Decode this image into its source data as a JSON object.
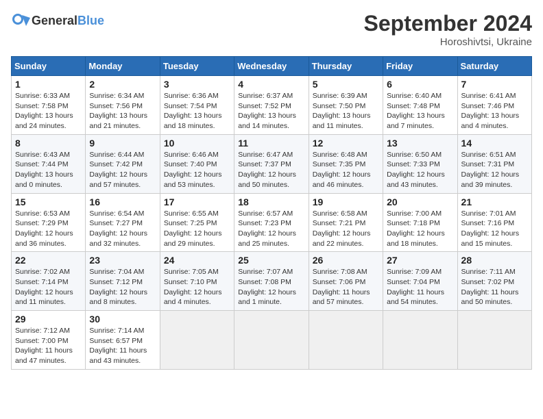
{
  "header": {
    "logo_general": "General",
    "logo_blue": "Blue",
    "month": "September 2024",
    "location": "Horoshivtsi, Ukraine"
  },
  "weekdays": [
    "Sunday",
    "Monday",
    "Tuesday",
    "Wednesday",
    "Thursday",
    "Friday",
    "Saturday"
  ],
  "weeks": [
    [
      {
        "day": 1,
        "info": "Sunrise: 6:33 AM\nSunset: 7:58 PM\nDaylight: 13 hours\nand 24 minutes."
      },
      {
        "day": 2,
        "info": "Sunrise: 6:34 AM\nSunset: 7:56 PM\nDaylight: 13 hours\nand 21 minutes."
      },
      {
        "day": 3,
        "info": "Sunrise: 6:36 AM\nSunset: 7:54 PM\nDaylight: 13 hours\nand 18 minutes."
      },
      {
        "day": 4,
        "info": "Sunrise: 6:37 AM\nSunset: 7:52 PM\nDaylight: 13 hours\nand 14 minutes."
      },
      {
        "day": 5,
        "info": "Sunrise: 6:39 AM\nSunset: 7:50 PM\nDaylight: 13 hours\nand 11 minutes."
      },
      {
        "day": 6,
        "info": "Sunrise: 6:40 AM\nSunset: 7:48 PM\nDaylight: 13 hours\nand 7 minutes."
      },
      {
        "day": 7,
        "info": "Sunrise: 6:41 AM\nSunset: 7:46 PM\nDaylight: 13 hours\nand 4 minutes."
      }
    ],
    [
      {
        "day": 8,
        "info": "Sunrise: 6:43 AM\nSunset: 7:44 PM\nDaylight: 13 hours\nand 0 minutes."
      },
      {
        "day": 9,
        "info": "Sunrise: 6:44 AM\nSunset: 7:42 PM\nDaylight: 12 hours\nand 57 minutes."
      },
      {
        "day": 10,
        "info": "Sunrise: 6:46 AM\nSunset: 7:40 PM\nDaylight: 12 hours\nand 53 minutes."
      },
      {
        "day": 11,
        "info": "Sunrise: 6:47 AM\nSunset: 7:37 PM\nDaylight: 12 hours\nand 50 minutes."
      },
      {
        "day": 12,
        "info": "Sunrise: 6:48 AM\nSunset: 7:35 PM\nDaylight: 12 hours\nand 46 minutes."
      },
      {
        "day": 13,
        "info": "Sunrise: 6:50 AM\nSunset: 7:33 PM\nDaylight: 12 hours\nand 43 minutes."
      },
      {
        "day": 14,
        "info": "Sunrise: 6:51 AM\nSunset: 7:31 PM\nDaylight: 12 hours\nand 39 minutes."
      }
    ],
    [
      {
        "day": 15,
        "info": "Sunrise: 6:53 AM\nSunset: 7:29 PM\nDaylight: 12 hours\nand 36 minutes."
      },
      {
        "day": 16,
        "info": "Sunrise: 6:54 AM\nSunset: 7:27 PM\nDaylight: 12 hours\nand 32 minutes."
      },
      {
        "day": 17,
        "info": "Sunrise: 6:55 AM\nSunset: 7:25 PM\nDaylight: 12 hours\nand 29 minutes."
      },
      {
        "day": 18,
        "info": "Sunrise: 6:57 AM\nSunset: 7:23 PM\nDaylight: 12 hours\nand 25 minutes."
      },
      {
        "day": 19,
        "info": "Sunrise: 6:58 AM\nSunset: 7:21 PM\nDaylight: 12 hours\nand 22 minutes."
      },
      {
        "day": 20,
        "info": "Sunrise: 7:00 AM\nSunset: 7:18 PM\nDaylight: 12 hours\nand 18 minutes."
      },
      {
        "day": 21,
        "info": "Sunrise: 7:01 AM\nSunset: 7:16 PM\nDaylight: 12 hours\nand 15 minutes."
      }
    ],
    [
      {
        "day": 22,
        "info": "Sunrise: 7:02 AM\nSunset: 7:14 PM\nDaylight: 12 hours\nand 11 minutes."
      },
      {
        "day": 23,
        "info": "Sunrise: 7:04 AM\nSunset: 7:12 PM\nDaylight: 12 hours\nand 8 minutes."
      },
      {
        "day": 24,
        "info": "Sunrise: 7:05 AM\nSunset: 7:10 PM\nDaylight: 12 hours\nand 4 minutes."
      },
      {
        "day": 25,
        "info": "Sunrise: 7:07 AM\nSunset: 7:08 PM\nDaylight: 12 hours\nand 1 minute."
      },
      {
        "day": 26,
        "info": "Sunrise: 7:08 AM\nSunset: 7:06 PM\nDaylight: 11 hours\nand 57 minutes."
      },
      {
        "day": 27,
        "info": "Sunrise: 7:09 AM\nSunset: 7:04 PM\nDaylight: 11 hours\nand 54 minutes."
      },
      {
        "day": 28,
        "info": "Sunrise: 7:11 AM\nSunset: 7:02 PM\nDaylight: 11 hours\nand 50 minutes."
      }
    ],
    [
      {
        "day": 29,
        "info": "Sunrise: 7:12 AM\nSunset: 7:00 PM\nDaylight: 11 hours\nand 47 minutes."
      },
      {
        "day": 30,
        "info": "Sunrise: 7:14 AM\nSunset: 6:57 PM\nDaylight: 11 hours\nand 43 minutes."
      },
      null,
      null,
      null,
      null,
      null
    ]
  ]
}
